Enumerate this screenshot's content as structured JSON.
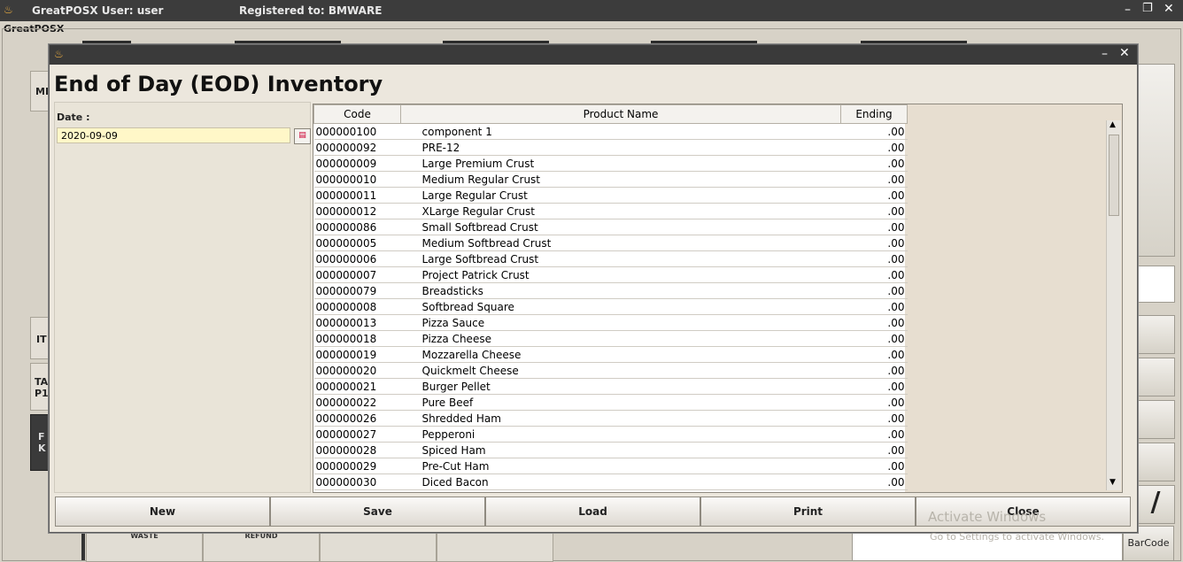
{
  "app": {
    "title": "GreatPOSX  User: user",
    "registered": "Registered to:  BMWARE",
    "frame_label": "GreatPOSX",
    "side_tabs": [
      "MI",
      "IT",
      "TA P1",
      "F K"
    ],
    "bg_buttons": [
      "WASTE",
      "REFUND",
      "",
      ""
    ],
    "barcode_label": "BarCode",
    "watermark_title": "Activate Windows",
    "watermark_sub": "Go to Settings to activate Windows."
  },
  "dialog": {
    "heading": "End of Day (EOD) Inventory",
    "date_label": "Date :",
    "date_value": "2020-09-09",
    "columns": [
      "Code",
      "Product Name",
      "Ending"
    ],
    "rows": [
      {
        "code": "000000100",
        "name": "component 1",
        "ending": ".00"
      },
      {
        "code": "000000092",
        "name": "PRE-12",
        "ending": ".00"
      },
      {
        "code": "000000009",
        "name": "Large Premium Crust",
        "ending": ".00"
      },
      {
        "code": "000000010",
        "name": "Medium Regular Crust",
        "ending": ".00"
      },
      {
        "code": "000000011",
        "name": "Large Regular Crust",
        "ending": ".00"
      },
      {
        "code": "000000012",
        "name": "XLarge Regular Crust",
        "ending": ".00"
      },
      {
        "code": "000000086",
        "name": "Small Softbread Crust",
        "ending": ".00"
      },
      {
        "code": "000000005",
        "name": "Medium Softbread Crust",
        "ending": ".00"
      },
      {
        "code": "000000006",
        "name": "Large Softbread Crust",
        "ending": ".00"
      },
      {
        "code": "000000007",
        "name": "Project Patrick Crust",
        "ending": ".00"
      },
      {
        "code": "000000079",
        "name": "Breadsticks",
        "ending": ".00"
      },
      {
        "code": "000000008",
        "name": "Softbread Square",
        "ending": ".00"
      },
      {
        "code": "000000013",
        "name": "Pizza Sauce",
        "ending": ".00"
      },
      {
        "code": "000000018",
        "name": "Pizza Cheese",
        "ending": ".00"
      },
      {
        "code": "000000019",
        "name": "Mozzarella Cheese",
        "ending": ".00"
      },
      {
        "code": "000000020",
        "name": "Quickmelt Cheese",
        "ending": ".00"
      },
      {
        "code": "000000021",
        "name": "Burger Pellet",
        "ending": ".00"
      },
      {
        "code": "000000022",
        "name": "Pure Beef",
        "ending": ".00"
      },
      {
        "code": "000000026",
        "name": "Shredded Ham",
        "ending": ".00"
      },
      {
        "code": "000000027",
        "name": "Pepperoni",
        "ending": ".00"
      },
      {
        "code": "000000028",
        "name": "Spiced Ham",
        "ending": ".00"
      },
      {
        "code": "000000029",
        "name": "Pre-Cut Ham",
        "ending": ".00"
      },
      {
        "code": "000000030",
        "name": "Diced Bacon",
        "ending": ".00"
      }
    ],
    "buttons": {
      "new": "New",
      "save": "Save",
      "load": "Load",
      "print": "Print",
      "close": "Close"
    }
  }
}
